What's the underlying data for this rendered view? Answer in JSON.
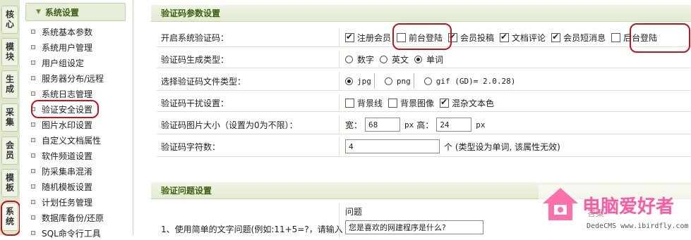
{
  "vtabs": [
    {
      "label": "核心",
      "active": false
    },
    {
      "label": "模块",
      "active": false
    },
    {
      "label": "生成",
      "active": false
    },
    {
      "label": "采集",
      "active": false
    },
    {
      "label": "会员",
      "active": false
    },
    {
      "label": "模板",
      "active": false
    },
    {
      "label": "系统",
      "active": true
    }
  ],
  "menu": {
    "header": "系统设置",
    "items": [
      "系统基本参数",
      "系统用户管理",
      "用户组设定",
      "服务器分布/远程",
      "系统日志管理",
      "验证安全设置",
      "图片水印设置",
      "自定义文档属性",
      "软件频道设置",
      "防采集串混淆",
      "随机模板设置",
      "计划任务管理",
      "数据库备份/还原",
      "SQL命令行工具"
    ],
    "active_item": "验证安全设置"
  },
  "captcha": {
    "title": "验证码参数设置",
    "enable": {
      "label": "开启系统验证码：",
      "options": [
        {
          "label": "注册会员",
          "checked": true
        },
        {
          "label": "前台登陆",
          "checked": false
        },
        {
          "label": "会员投稿",
          "checked": true
        },
        {
          "label": "文档评论",
          "checked": true
        },
        {
          "label": "会员短消息",
          "checked": true
        },
        {
          "label": "后台登陆",
          "checked": false
        }
      ]
    },
    "type": {
      "label": "验证码生成类型：",
      "options": [
        {
          "label": "数字",
          "checked": false
        },
        {
          "label": "英文",
          "checked": false
        },
        {
          "label": "单词",
          "checked": true
        }
      ]
    },
    "filetype": {
      "label": "选择验证码文件类型：",
      "options": [
        {
          "label": "jpg",
          "checked": true
        },
        {
          "label": "png",
          "checked": false
        },
        {
          "label": "gif (GD)= 2.0.28)",
          "checked": false
        }
      ]
    },
    "noise": {
      "label": "验证码干扰设置：",
      "options": [
        {
          "label": "背景线",
          "checked": false
        },
        {
          "label": "背景图像",
          "checked": false
        },
        {
          "label": "混杂文本色",
          "checked": true
        }
      ]
    },
    "size": {
      "label": "验证码图片大小（设置为0为不限）：",
      "width_label": "宽：",
      "width_value": "68",
      "unit1": "px",
      "height_label": "高：",
      "height_value": "24",
      "unit2": "px"
    },
    "chars": {
      "label": "验证码字符数：",
      "value": "4",
      "note": "个 (类型设为单词, 该属性无效)"
    }
  },
  "question": {
    "title": "验证问题设置",
    "col_question": "问题",
    "row_label": "1、使用简单的文字问题(例如:11+5=?，请输入",
    "question_value": "您是喜欢的网建程序是什么?",
    "answer_label": "答案"
  },
  "watermark": {
    "text": "电脑爱好者",
    "url": "DedeCMS www.ibirdfly.com"
  },
  "colors": {
    "accent": "#3d5f13",
    "highlight_ring": "#c0141b"
  }
}
